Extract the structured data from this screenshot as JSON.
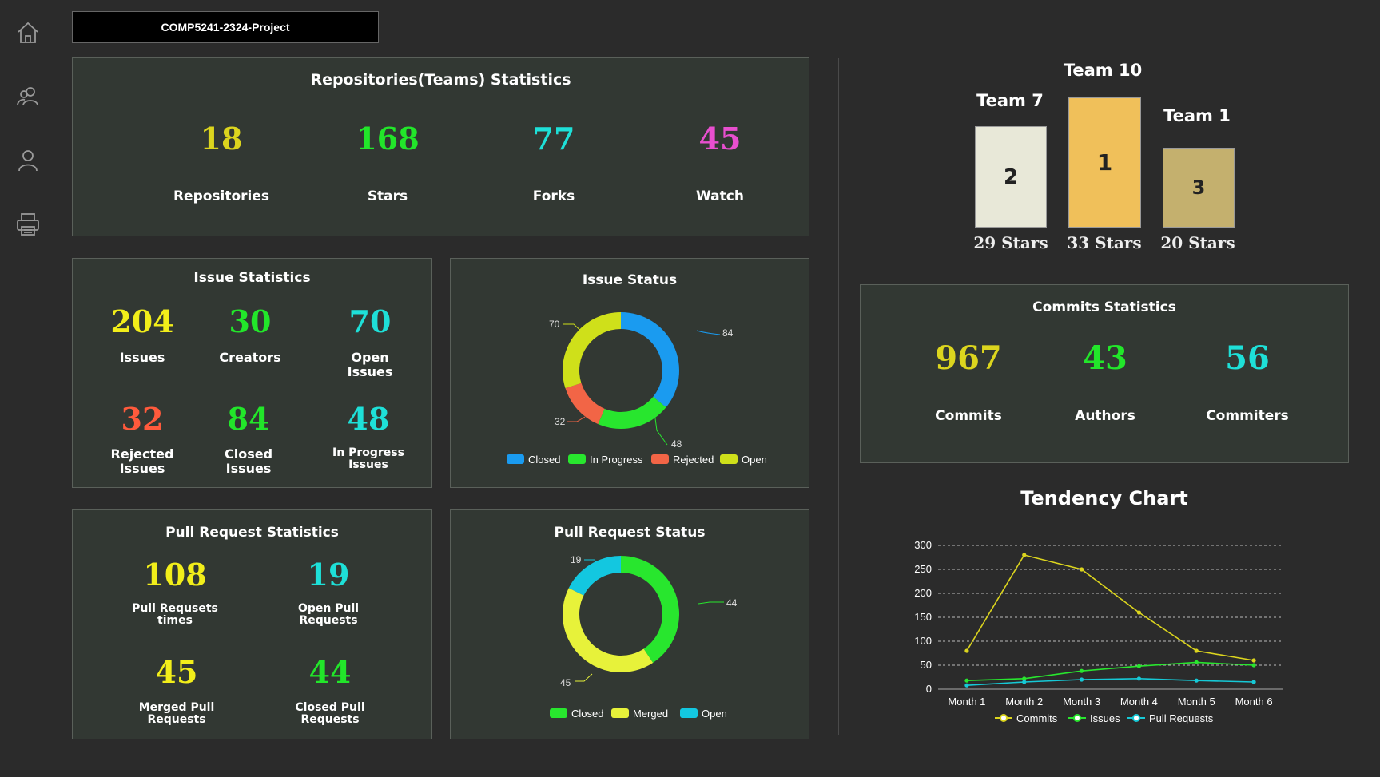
{
  "project_title": "COMP5241-2324-Project",
  "nav": [
    {
      "icon": "home-icon"
    },
    {
      "icon": "users-icon"
    },
    {
      "icon": "user-icon"
    },
    {
      "icon": "printer-icon"
    }
  ],
  "repo_stats": {
    "title": "Repositories(Teams) Statistics",
    "items": [
      {
        "value": "18",
        "label": "Repositories",
        "color": "#dcd51e"
      },
      {
        "value": "168",
        "label": "Stars",
        "color": "#22e62a"
      },
      {
        "value": "77",
        "label": "Forks",
        "color": "#1ee0d8"
      },
      {
        "value": "45",
        "label": "Watch",
        "color": "#e84fcf"
      }
    ]
  },
  "issue_stats": {
    "title": "Issue Statistics",
    "items": [
      {
        "value": "204",
        "label": "Issues",
        "color": "#f2ee1a"
      },
      {
        "value": "30",
        "label": "Creators",
        "color": "#22e62a"
      },
      {
        "value": "70",
        "label": "Open Issues",
        "color": "#1ee0d8"
      },
      {
        "value": "32",
        "label": "Rejected Issues",
        "color": "#ff5a3c"
      },
      {
        "value": "84",
        "label": "Closed Issues",
        "color": "#22e62a"
      },
      {
        "value": "48",
        "label": "In Progress Issues",
        "color": "#1ee0d8"
      }
    ]
  },
  "issue_status": {
    "title": "Issue Status",
    "legend": [
      {
        "name": "Closed",
        "color": "#1a9bf0"
      },
      {
        "name": "In Progress",
        "color": "#28e62e"
      },
      {
        "name": "Rejected",
        "color": "#f26546"
      },
      {
        "name": "Open",
        "color": "#cfe01a"
      }
    ],
    "labels": {
      "closed": "84",
      "in_progress": "48",
      "rejected": "32",
      "open": "70"
    }
  },
  "pr_stats": {
    "title": "Pull Request Statistics",
    "items": [
      {
        "value": "108",
        "label": "Pull Requsets times",
        "color": "#f2ee1a"
      },
      {
        "value": "19",
        "label": "Open Pull Requests",
        "color": "#1ee0d8"
      },
      {
        "value": "45",
        "label": "Merged Pull Requests",
        "color": "#f2ee1a"
      },
      {
        "value": "44",
        "label": "Closed Pull Requests",
        "color": "#22e62a"
      }
    ]
  },
  "pr_status": {
    "title": "Pull Request Status",
    "legend": [
      {
        "name": "Closed",
        "color": "#28e62e"
      },
      {
        "name": "Merged",
        "color": "#e7f23a"
      },
      {
        "name": "Open",
        "color": "#13c7e0"
      }
    ],
    "labels": {
      "closed": "44",
      "merged": "45",
      "open": "19"
    }
  },
  "podium": [
    {
      "team": "Team 7",
      "rank": "2",
      "stars": "29 Stars",
      "color": "#e8e8d8"
    },
    {
      "team": "Team 10",
      "rank": "1",
      "stars": "33 Stars",
      "color": "#f0c05a"
    },
    {
      "team": "Team 1",
      "rank": "3",
      "stars": "20 Stars",
      "color": "#c4b06e"
    }
  ],
  "commit_stats": {
    "title": "Commits Statistics",
    "items": [
      {
        "value": "967",
        "label": "Commits",
        "color": "#dcd51e"
      },
      {
        "value": "43",
        "label": "Authors",
        "color": "#22e62a"
      },
      {
        "value": "56",
        "label": "Commiters",
        "color": "#1ee0d8"
      }
    ]
  },
  "chart_data": [
    {
      "type": "pie",
      "title": "Issue Status",
      "categories": [
        "Closed",
        "In Progress",
        "Rejected",
        "Open"
      ],
      "values": [
        84,
        48,
        32,
        70
      ],
      "colors": [
        "#1a9bf0",
        "#28e62e",
        "#f26546",
        "#cfe01a"
      ]
    },
    {
      "type": "pie",
      "title": "Pull Request Status",
      "categories": [
        "Closed",
        "Merged",
        "Open"
      ],
      "values": [
        44,
        45,
        19
      ],
      "colors": [
        "#28e62e",
        "#e7f23a",
        "#13c7e0"
      ]
    },
    {
      "type": "line",
      "title": "Tendency Chart",
      "categories": [
        "Month 1",
        "Month 2",
        "Month 3",
        "Month 4",
        "Month 5",
        "Month 6"
      ],
      "series": [
        {
          "name": "Commits",
          "values": [
            80,
            280,
            250,
            160,
            80,
            60
          ],
          "color": "#dcd51e"
        },
        {
          "name": "Issues",
          "values": [
            18,
            22,
            38,
            48,
            56,
            50
          ],
          "color": "#28e62e"
        },
        {
          "name": "Pull Requests",
          "values": [
            8,
            15,
            20,
            22,
            18,
            15
          ],
          "color": "#16c9d6"
        }
      ],
      "yticks": [
        "0",
        "50",
        "100",
        "150",
        "200",
        "250",
        "300"
      ],
      "ylim": [
        0,
        300
      ],
      "grid": true,
      "legend": "bottom"
    }
  ]
}
